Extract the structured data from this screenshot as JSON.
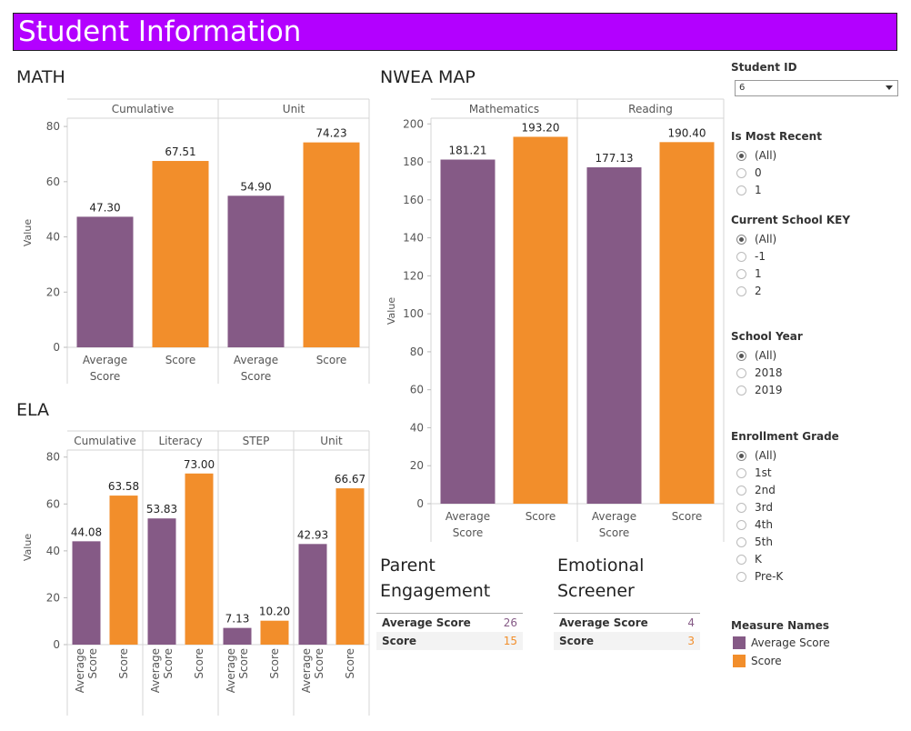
{
  "header": {
    "title": "Student Information"
  },
  "colors": {
    "average": "#855a86",
    "score": "#f28e2b",
    "banner": "#b300ff"
  },
  "sections": {
    "math": "MATH",
    "ela": "ELA",
    "nwea": "NWEA MAP",
    "parent": [
      "Parent",
      "Engagement"
    ],
    "emotional": [
      "Emotional",
      "Screener"
    ]
  },
  "chart_data": [
    {
      "type": "bar",
      "title": "MATH",
      "ylabel": "Value",
      "ylim": [
        0,
        83
      ],
      "yticks": [
        0,
        20,
        40,
        60,
        80
      ],
      "panels": [
        {
          "name": "Cumulative",
          "categories": [
            "Average Score",
            "Score"
          ],
          "values": [
            47.3,
            67.51
          ],
          "labels": [
            "47.30",
            "67.51"
          ]
        },
        {
          "name": "Unit",
          "categories": [
            "Average Score",
            "Score"
          ],
          "values": [
            54.9,
            74.23
          ],
          "labels": [
            "54.90",
            "74.23"
          ]
        }
      ]
    },
    {
      "type": "bar",
      "title": "NWEA MAP",
      "ylabel": "Value",
      "ylim": [
        0,
        203
      ],
      "yticks": [
        0,
        20,
        40,
        60,
        80,
        100,
        120,
        140,
        160,
        180,
        200
      ],
      "panels": [
        {
          "name": "Mathematics",
          "categories": [
            "Average Score",
            "Score"
          ],
          "values": [
            181.21,
            193.2
          ],
          "labels": [
            "181.21",
            "193.20"
          ]
        },
        {
          "name": "Reading",
          "categories": [
            "Average Score",
            "Score"
          ],
          "values": [
            177.13,
            190.4
          ],
          "labels": [
            "177.13",
            "190.40"
          ]
        }
      ]
    },
    {
      "type": "bar",
      "title": "ELA",
      "ylabel": "Value",
      "ylim": [
        0,
        83
      ],
      "yticks": [
        0,
        20,
        40,
        60,
        80
      ],
      "panels": [
        {
          "name": "Cumulative",
          "categories": [
            "Average Score",
            "Score"
          ],
          "values": [
            44.08,
            63.58
          ],
          "labels": [
            "44.08",
            "63.58"
          ]
        },
        {
          "name": "Literacy",
          "categories": [
            "Average Score",
            "Score"
          ],
          "values": [
            53.83,
            73.0
          ],
          "labels": [
            "53.83",
            "73.00"
          ]
        },
        {
          "name": "STEP",
          "categories": [
            "Average Score",
            "Score"
          ],
          "values": [
            7.13,
            10.2
          ],
          "labels": [
            "7.13",
            "10.20"
          ]
        },
        {
          "name": "Unit",
          "categories": [
            "Average Score",
            "Score"
          ],
          "values": [
            42.93,
            66.67
          ],
          "labels": [
            "42.93",
            "66.67"
          ]
        }
      ]
    }
  ],
  "kpis": {
    "parent": [
      {
        "label": "Average Score",
        "value": "26"
      },
      {
        "label": "Score",
        "value": "15"
      }
    ],
    "emotional": [
      {
        "label": "Average Score",
        "value": "4"
      },
      {
        "label": "Score",
        "value": "3"
      }
    ]
  },
  "filters": {
    "student_id": {
      "title": "Student ID",
      "value": "6"
    },
    "groups": [
      {
        "title": "Is Most Recent",
        "options": [
          "(All)",
          "0",
          "1"
        ],
        "selected": 0
      },
      {
        "title": "Current School KEY",
        "options": [
          "(All)",
          "-1",
          "1",
          "2"
        ],
        "selected": 0
      },
      {
        "title": "School Year",
        "options": [
          "(All)",
          "2018",
          "2019"
        ],
        "selected": 0
      },
      {
        "title": "Enrollment Grade",
        "options": [
          "(All)",
          "1st",
          "2nd",
          "3rd",
          "4th",
          "5th",
          "K",
          "Pre-K"
        ],
        "selected": 0
      }
    ]
  },
  "legend": {
    "title": "Measure Names",
    "items": [
      "Average Score",
      "Score"
    ]
  }
}
